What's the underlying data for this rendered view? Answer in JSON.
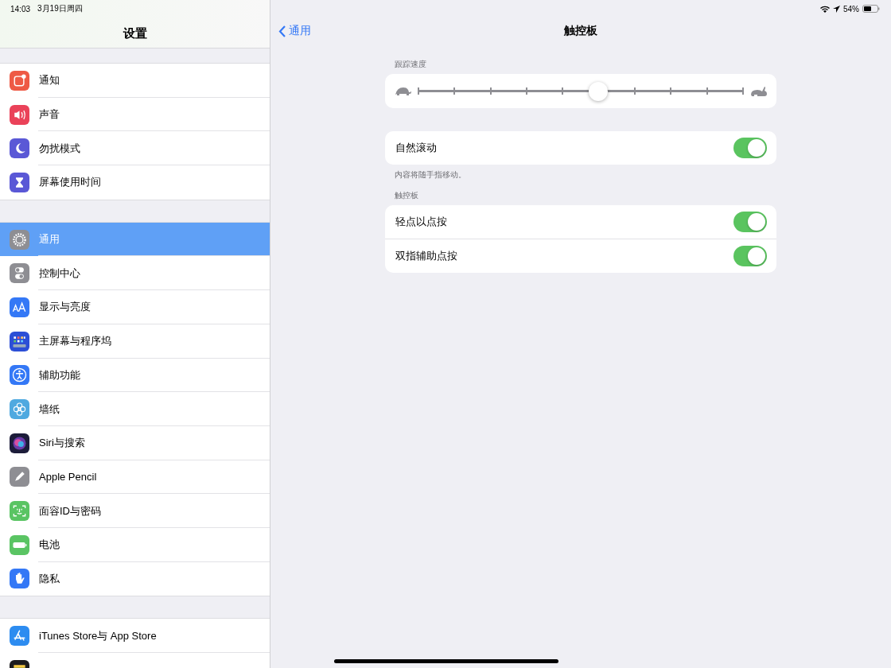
{
  "status_bar": {
    "time": "14:03",
    "date": "3月19日周四",
    "battery": "54%"
  },
  "sidebar": {
    "title": "设置",
    "groups": [
      {
        "items": [
          {
            "label": "通知",
            "kind": "notify",
            "selected": false
          },
          {
            "label": "声音",
            "kind": "sound",
            "selected": false
          },
          {
            "label": "勿扰模式",
            "kind": "moon",
            "selected": false
          },
          {
            "label": "屏幕使用时间",
            "kind": "hourglass",
            "selected": false
          }
        ]
      },
      {
        "items": [
          {
            "label": "通用",
            "kind": "gear",
            "selected": true
          },
          {
            "label": "控制中心",
            "kind": "switches",
            "selected": false
          },
          {
            "label": "显示与亮度",
            "kind": "text",
            "selected": false
          },
          {
            "label": "主屏幕与程序坞",
            "kind": "grid",
            "selected": false
          },
          {
            "label": "辅助功能",
            "kind": "access",
            "selected": false
          },
          {
            "label": "墙纸",
            "kind": "flower",
            "selected": false
          },
          {
            "label": "Siri与搜索",
            "kind": "siri",
            "selected": false
          },
          {
            "label": "Apple Pencil",
            "kind": "pencil",
            "selected": false
          },
          {
            "label": "面容ID与密码",
            "kind": "face",
            "selected": false
          },
          {
            "label": "电池",
            "kind": "battery",
            "selected": false
          },
          {
            "label": "隐私",
            "kind": "hand",
            "selected": false
          }
        ]
      },
      {
        "items": [
          {
            "label": "iTunes Store与 App Store",
            "kind": "store",
            "selected": false
          },
          {
            "kind": "wallet",
            "selected": false
          }
        ]
      }
    ]
  },
  "detail": {
    "back": "通用",
    "title": "触控板",
    "speed": {
      "header": "跟踪速度",
      "level": 0.555
    },
    "scroll": {
      "label": "自然滚动",
      "on": true,
      "footer": "内容将随手指移动。"
    },
    "trackpad": {
      "header": "触控板",
      "rows": [
        {
          "label": "轻点以点按",
          "on": true
        },
        {
          "label": "双指辅助点按",
          "on": true
        }
      ]
    }
  }
}
